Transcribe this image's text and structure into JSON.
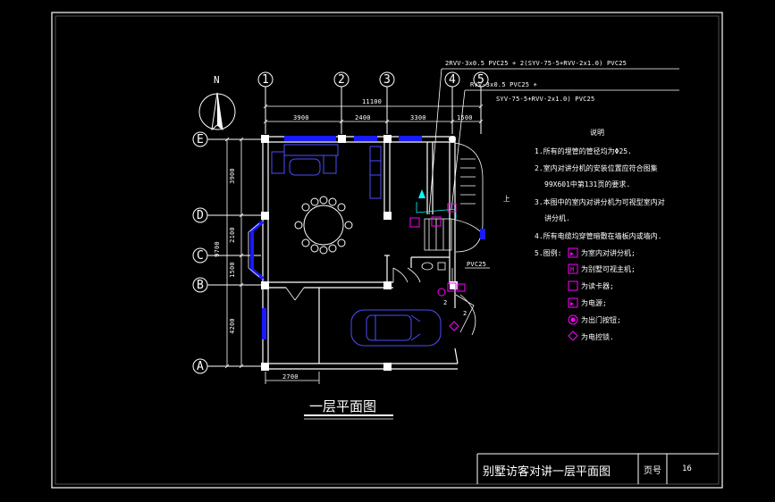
{
  "drawing": {
    "north_label": "N",
    "axes": {
      "vertical": [
        "1",
        "2",
        "3",
        "4",
        "5"
      ],
      "horizontal": [
        "E",
        "D",
        "C",
        "B",
        "A"
      ]
    },
    "dimensions": {
      "total_top": "11100",
      "top_segments": [
        "3900",
        "2400",
        "3300",
        "1500"
      ],
      "left_total": "9700",
      "left_segments": [
        "3900",
        "2100",
        "1500",
        "4200"
      ],
      "bottom_segment": "2700"
    },
    "cable_labels": {
      "cable_a": "2RVV-3x0.5 PVC25 + 2(SYV-75-5+RVV-2x1.0) PVC25",
      "cable_b1": "RVV-3x0.5 PVC25 +",
      "cable_b2": "SYV-75-5+RVV-2x1.0) PVC25",
      "cable_c": "PVC25",
      "stair_up": "上",
      "marker_2a": "2",
      "marker_2b": "2"
    },
    "title": "一层平面图"
  },
  "notes": {
    "heading": "说明",
    "lines": [
      "1.所有的埋管的管径均为Φ25.",
      "2.室内对讲分机的安装位置应符合图集",
      "99X601中第131页的要求.",
      "3.本图中的室内对讲分机为可视型室内对",
      "讲分机.",
      "4.所有电缆均穿管暗敷在墙板内或墙内.",
      "5.图例:"
    ],
    "legend": [
      {
        "symbol": "▶",
        "label": "为室内对讲分机;"
      },
      {
        "symbol": "M",
        "label": "为别墅可视主机;"
      },
      {
        "symbol": "",
        "label": "为读卡器;"
      },
      {
        "symbol": "▶",
        "label": "为电源;"
      },
      {
        "symbol": "◉",
        "label": "为出门按钮;"
      },
      {
        "symbol": "◆",
        "label": "为电控锁."
      }
    ]
  },
  "title_block": {
    "name": "别墅访客对讲一层平面图",
    "page_label": "页号",
    "page_number": "16"
  },
  "colors": {
    "background": "#000000",
    "line": "#ffffff",
    "window": "#1a1aff",
    "device": "#ff00ff",
    "cable": "#00ffff"
  }
}
